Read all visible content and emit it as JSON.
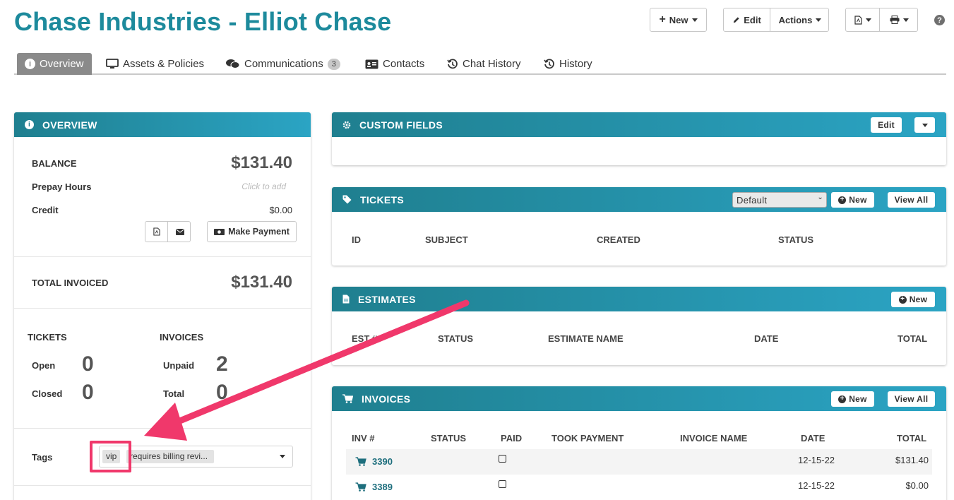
{
  "header": {
    "title": "Chase Industries - Elliot Chase",
    "new_label": "New",
    "edit_label": "Edit",
    "actions_label": "Actions",
    "help": "?"
  },
  "tabs": [
    {
      "label": "Overview",
      "icon": "info-icon"
    },
    {
      "label": "Assets & Policies",
      "icon": "monitor-icon"
    },
    {
      "label": "Communications",
      "icon": "comments-icon",
      "badge": "3"
    },
    {
      "label": "Contacts",
      "icon": "id-card-icon"
    },
    {
      "label": "Chat History",
      "icon": "history-icon"
    },
    {
      "label": "History",
      "icon": "history-icon"
    }
  ],
  "overview": {
    "title": "OVERVIEW",
    "balance_label": "BALANCE",
    "balance_value": "$131.40",
    "prepay_label": "Prepay Hours",
    "prepay_placeholder": "Click to add",
    "credit_label": "Credit",
    "credit_value": "$0.00",
    "make_payment_label": "Make Payment",
    "total_invoiced_label": "TOTAL INVOICED",
    "total_invoiced_value": "$131.40",
    "tickets_label": "TICKETS",
    "invoices_label": "INVOICES",
    "open_label": "Open",
    "open_value": "0",
    "closed_label": "Closed",
    "closed_value": "0",
    "unpaid_label": "Unpaid",
    "unpaid_value": "2",
    "total_label": "Total",
    "total_value": "0",
    "tags_label": "Tags",
    "tags": [
      "vip",
      "requires billing revi..."
    ]
  },
  "custom_fields": {
    "title": "CUSTOM FIELDS",
    "edit_label": "Edit"
  },
  "tickets": {
    "title": "TICKETS",
    "filter_selected": "Default",
    "new_label": "New",
    "view_all_label": "View All",
    "columns": [
      "ID",
      "SUBJECT",
      "CREATED",
      "STATUS"
    ]
  },
  "estimates": {
    "title": "ESTIMATES",
    "new_label": "New",
    "columns": [
      "EST #",
      "STATUS",
      "ESTIMATE NAME",
      "DATE",
      "TOTAL"
    ]
  },
  "invoices": {
    "title": "INVOICES",
    "new_label": "New",
    "view_all_label": "View All",
    "columns": [
      "INV #",
      "STATUS",
      "PAID",
      "TOOK PAYMENT",
      "INVOICE NAME",
      "DATE",
      "TOTAL"
    ],
    "rows": [
      {
        "number": "3390",
        "paid": false,
        "date": "12-15-22",
        "total": "$131.40"
      },
      {
        "number": "3389",
        "paid": false,
        "date": "12-15-22",
        "total": "$0.00"
      }
    ]
  },
  "colors": {
    "title": "#1d8a9c",
    "panel_header_start": "#1f7f8f",
    "panel_header_end": "#2ba4c4",
    "highlight": "#f0386b"
  }
}
